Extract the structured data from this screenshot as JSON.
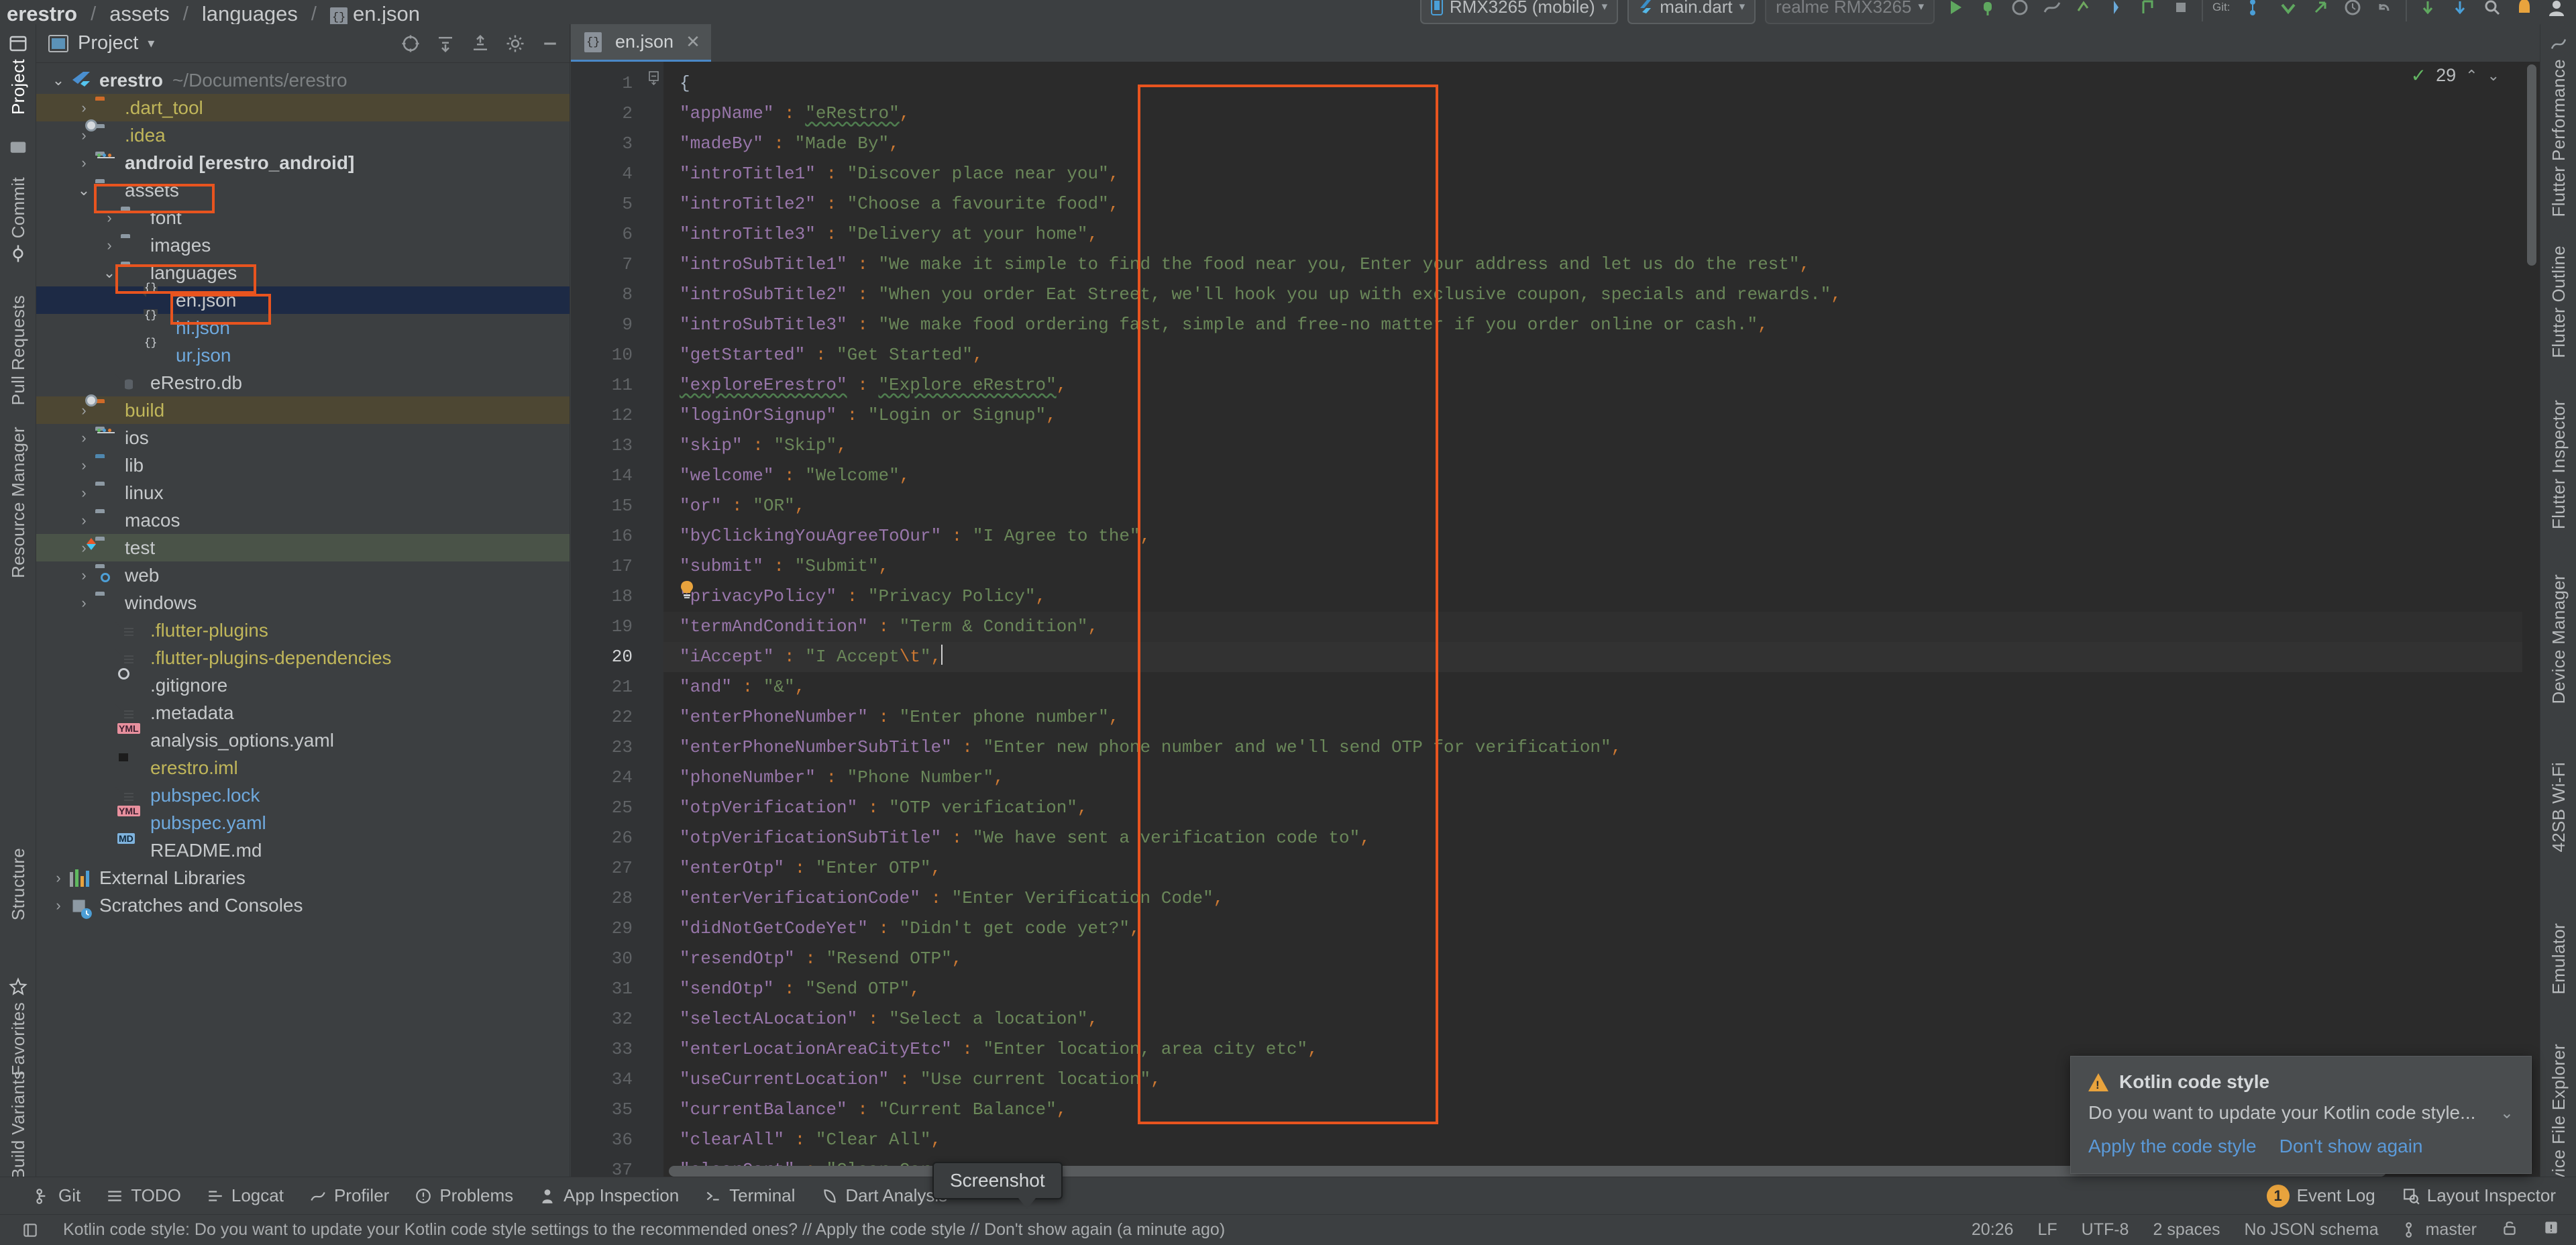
{
  "breadcrumb": {
    "items": [
      "erestro",
      "assets",
      "languages",
      "en.json"
    ],
    "separator": "/"
  },
  "run_toolbar": {
    "device": "RMX3265 (mobile)",
    "config": "main.dart",
    "device_secondary": "realme RMX3265",
    "caret": "▾"
  },
  "left_strip": {
    "tabs": [
      "Project",
      "Commit",
      "Pull Requests",
      "Resource Manager",
      "Structure",
      "Favorites",
      "Build Variants"
    ]
  },
  "right_strip": {
    "tabs": [
      "Flutter Performance",
      "Flutter Outline",
      "Flutter Inspector",
      "Device Manager",
      "42SB Wi-Fi",
      "Emulator",
      "Device File Explorer"
    ]
  },
  "project_panel": {
    "title": "Project",
    "title_caret": "▾",
    "tree": [
      {
        "indent": 0,
        "arrow": "v",
        "icon": "flutter-logo",
        "label": "erestro",
        "style": "bold",
        "sub": "~/Documents/erestro",
        "row": ""
      },
      {
        "indent": 1,
        "arrow": ">",
        "icon": "folder-orange",
        "label": ".dart_tool",
        "style": "yellow",
        "sub": "",
        "row": "hl-olive"
      },
      {
        "indent": 1,
        "arrow": ">",
        "icon": "folder-gear",
        "label": ".idea",
        "style": "yellow",
        "sub": "",
        "row": ""
      },
      {
        "indent": 1,
        "arrow": ">",
        "icon": "folder-module",
        "label": "android [erestro_android]",
        "style": "bold",
        "sub": "",
        "row": ""
      },
      {
        "indent": 1,
        "arrow": "v",
        "icon": "folder",
        "label": "assets",
        "style": "white",
        "sub": "",
        "row": ""
      },
      {
        "indent": 2,
        "arrow": ">",
        "icon": "folder",
        "label": "font",
        "style": "white",
        "sub": "",
        "row": ""
      },
      {
        "indent": 2,
        "arrow": ">",
        "icon": "folder",
        "label": "images",
        "style": "white",
        "sub": "",
        "row": ""
      },
      {
        "indent": 2,
        "arrow": "v",
        "icon": "folder",
        "label": "languages",
        "style": "white",
        "sub": "",
        "row": ""
      },
      {
        "indent": 3,
        "arrow": "",
        "icon": "json-file",
        "label": "en.json",
        "style": "white",
        "sub": "",
        "row": "sel"
      },
      {
        "indent": 3,
        "arrow": "",
        "icon": "json-file",
        "label": "hi.json",
        "style": "blue",
        "sub": "",
        "row": ""
      },
      {
        "indent": 3,
        "arrow": "",
        "icon": "json-file",
        "label": "ur.json",
        "style": "blue",
        "sub": "",
        "row": ""
      },
      {
        "indent": 2,
        "arrow": "",
        "icon": "db-file",
        "label": "eRestro.db",
        "style": "white",
        "sub": "",
        "row": ""
      },
      {
        "indent": 1,
        "arrow": ">",
        "icon": "folder-orange-gear",
        "label": "build",
        "style": "yellow",
        "sub": "",
        "row": "hl-olive"
      },
      {
        "indent": 1,
        "arrow": ">",
        "icon": "folder-module",
        "label": "ios",
        "style": "white",
        "sub": "",
        "row": ""
      },
      {
        "indent": 1,
        "arrow": ">",
        "icon": "folder-blue",
        "label": "lib",
        "style": "white",
        "sub": "",
        "row": ""
      },
      {
        "indent": 1,
        "arrow": ">",
        "icon": "folder",
        "label": "linux",
        "style": "white",
        "sub": "",
        "row": ""
      },
      {
        "indent": 1,
        "arrow": ">",
        "icon": "folder",
        "label": "macos",
        "style": "white",
        "sub": "",
        "row": ""
      },
      {
        "indent": 1,
        "arrow": ">",
        "icon": "folder-dart",
        "label": "test",
        "style": "white",
        "sub": "",
        "row": "hl-green"
      },
      {
        "indent": 1,
        "arrow": ">",
        "icon": "folder-web",
        "label": "web",
        "style": "white",
        "sub": "",
        "row": ""
      },
      {
        "indent": 1,
        "arrow": ">",
        "icon": "folder",
        "label": "windows",
        "style": "white",
        "sub": "",
        "row": ""
      },
      {
        "indent": 2,
        "arrow": "",
        "icon": "text-file",
        "label": ".flutter-plugins",
        "style": "yellow",
        "sub": "",
        "row": ""
      },
      {
        "indent": 2,
        "arrow": "",
        "icon": "text-file",
        "label": ".flutter-plugins-dependencies",
        "style": "yellow",
        "sub": "",
        "row": ""
      },
      {
        "indent": 2,
        "arrow": "",
        "icon": "gitignore-file",
        "label": ".gitignore",
        "style": "white",
        "sub": "",
        "row": ""
      },
      {
        "indent": 2,
        "arrow": "",
        "icon": "text-file",
        "label": ".metadata",
        "style": "white",
        "sub": "",
        "row": ""
      },
      {
        "indent": 2,
        "arrow": "",
        "icon": "yaml-file",
        "label": "analysis_options.yaml",
        "style": "white",
        "sub": "",
        "row": ""
      },
      {
        "indent": 2,
        "arrow": "",
        "icon": "iml-file",
        "label": "erestro.iml",
        "style": "yellow",
        "sub": "",
        "row": ""
      },
      {
        "indent": 2,
        "arrow": "",
        "icon": "text-file",
        "label": "pubspec.lock",
        "style": "blue",
        "sub": "",
        "row": ""
      },
      {
        "indent": 2,
        "arrow": "",
        "icon": "yaml-file",
        "label": "pubspec.yaml",
        "style": "blue",
        "sub": "",
        "row": ""
      },
      {
        "indent": 2,
        "arrow": "",
        "icon": "md-file",
        "label": "README.md",
        "style": "white",
        "sub": "",
        "row": ""
      },
      {
        "indent": 0,
        "arrow": ">",
        "icon": "libraries",
        "label": "External Libraries",
        "style": "white",
        "sub": "",
        "row": ""
      },
      {
        "indent": 0,
        "arrow": ">",
        "icon": "scratches",
        "label": "Scratches and Consoles",
        "style": "white",
        "sub": "",
        "row": ""
      }
    ]
  },
  "editor": {
    "tab_label": "en.json",
    "tab_close": "✕",
    "inspections_count": "29",
    "inspection_check": "✓",
    "up_arrow": "⌃",
    "down_arrow": "⌄",
    "lines": [
      {
        "n": "1",
        "t": "{",
        "type": "brace"
      },
      {
        "n": "2",
        "k": "\"appName\"",
        "v": "\"eRestro\"",
        "wavy_v": true
      },
      {
        "n": "3",
        "k": "\"madeBy\"",
        "v": "\"Made By\""
      },
      {
        "n": "4",
        "k": "\"introTitle1\"",
        "v": "\"Discover place near you\""
      },
      {
        "n": "5",
        "k": "\"introTitle2\"",
        "v": "\"Choose a favourite food\""
      },
      {
        "n": "6",
        "k": "\"introTitle3\"",
        "v": "\"Delivery at your home\""
      },
      {
        "n": "7",
        "k": "\"introSubTitle1\"",
        "v": "\"We make it simple to find the food near you, Enter your address and let us do the rest\""
      },
      {
        "n": "8",
        "k": "\"introSubTitle2\"",
        "v": "\"When you order Eat Street, we'll hook you up with exclusive coupon, specials and rewards.\""
      },
      {
        "n": "9",
        "k": "\"introSubTitle3\"",
        "v": "\"We make food ordering fast, simple and free-no matter if you order online or cash.\""
      },
      {
        "n": "10",
        "k": "\"getStarted\"",
        "v": "\"Get Started\""
      },
      {
        "n": "11",
        "k": "\"exploreErestro\"",
        "v": "\"Explore eRestro\"",
        "wavy_k": true,
        "wavy_v": true
      },
      {
        "n": "12",
        "k": "\"loginOrSignup\"",
        "v": "\"Login or Signup\""
      },
      {
        "n": "13",
        "k": "\"skip\"",
        "v": "\"Skip\""
      },
      {
        "n": "14",
        "k": "\"welcome\"",
        "v": "\"Welcome\""
      },
      {
        "n": "15",
        "k": "\"or\"",
        "v": "\"OR\""
      },
      {
        "n": "16",
        "k": "\"byClickingYouAgreeToOur\"",
        "v": "\"I Agree to the\""
      },
      {
        "n": "17",
        "k": "\"submit\"",
        "v": "\"Submit\""
      },
      {
        "n": "18",
        "k": "\"privacyPolicy\"",
        "v": "\"Privacy Policy\""
      },
      {
        "n": "19",
        "k": "\"termAndCondition\"",
        "v": "\"Term & Condition\"",
        "bulb": true
      },
      {
        "n": "20",
        "k": "\"iAccept\"",
        "v": "\"I Accept\\t\"",
        "cursor": true,
        "escape": "\\t"
      },
      {
        "n": "21",
        "k": "\"and\"",
        "v": "\"&\""
      },
      {
        "n": "22",
        "k": "\"enterPhoneNumber\"",
        "v": "\"Enter phone number\""
      },
      {
        "n": "23",
        "k": "\"enterPhoneNumberSubTitle\"",
        "v": "\"Enter new phone number and we'll send OTP for verification\""
      },
      {
        "n": "24",
        "k": "\"phoneNumber\"",
        "v": "\"Phone Number\""
      },
      {
        "n": "25",
        "k": "\"otpVerification\"",
        "v": "\"OTP verification\""
      },
      {
        "n": "26",
        "k": "\"otpVerificationSubTitle\"",
        "v": "\"We have sent a verification code to\""
      },
      {
        "n": "27",
        "k": "\"enterOtp\"",
        "v": "\"Enter OTP\""
      },
      {
        "n": "28",
        "k": "\"enterVerificationCode\"",
        "v": "\"Enter Verification Code\""
      },
      {
        "n": "29",
        "k": "\"didNotGetCodeYet\"",
        "v": "\"Didn't get code yet?\""
      },
      {
        "n": "30",
        "k": "\"resendOtp\"",
        "v": "\"Resend OTP\""
      },
      {
        "n": "31",
        "k": "\"sendOtp\"",
        "v": "\"Send OTP\""
      },
      {
        "n": "32",
        "k": "\"selectALocation\"",
        "v": "\"Select a location\""
      },
      {
        "n": "33",
        "k": "\"enterLocationAreaCityEtc\"",
        "v": "\"Enter location, area city etc\""
      },
      {
        "n": "34",
        "k": "\"useCurrentLocation\"",
        "v": "\"Use current location\""
      },
      {
        "n": "35",
        "k": "\"currentBalance\"",
        "v": "\"Current Balance\""
      },
      {
        "n": "36",
        "k": "\"clearAll\"",
        "v": "\"Clear All\""
      },
      {
        "n": "37",
        "k": "\"clearCart\"",
        "v": "\"Clear Cart\""
      }
    ]
  },
  "balloon": {
    "title": "Kotlin code style",
    "message": "Do you want to update your Kotlin code style...",
    "chevron": "⌄",
    "action_primary": "Apply the code style",
    "action_secondary": "Don't show again"
  },
  "tooltip": {
    "text": "Screenshot"
  },
  "bottom_bar": {
    "items": [
      "Git",
      "TODO",
      "Logcat",
      "Profiler",
      "Problems",
      "App Inspection",
      "Terminal",
      "Dart Analysis"
    ],
    "right": [
      {
        "label": "Event Log",
        "badge": "1"
      },
      {
        "label": "Layout Inspector",
        "badge": ""
      }
    ]
  },
  "status_bar": {
    "message": "Kotlin code style: Do you want to update your Kotlin code style settings to the recommended ones? // Apply the code style // Don't show again (a minute ago)",
    "right": [
      "20:26",
      "LF",
      "UTF-8",
      "2 spaces",
      "No JSON schema",
      "master"
    ]
  },
  "colors": {
    "annotation": "#e8541f",
    "selection": "#1d2a45",
    "accent_blue": "#4a88c7",
    "string_green": "#6a8759",
    "key_purple": "#9876aa",
    "punct_orange": "#cc7832",
    "warn_amber": "#e8a33d"
  }
}
